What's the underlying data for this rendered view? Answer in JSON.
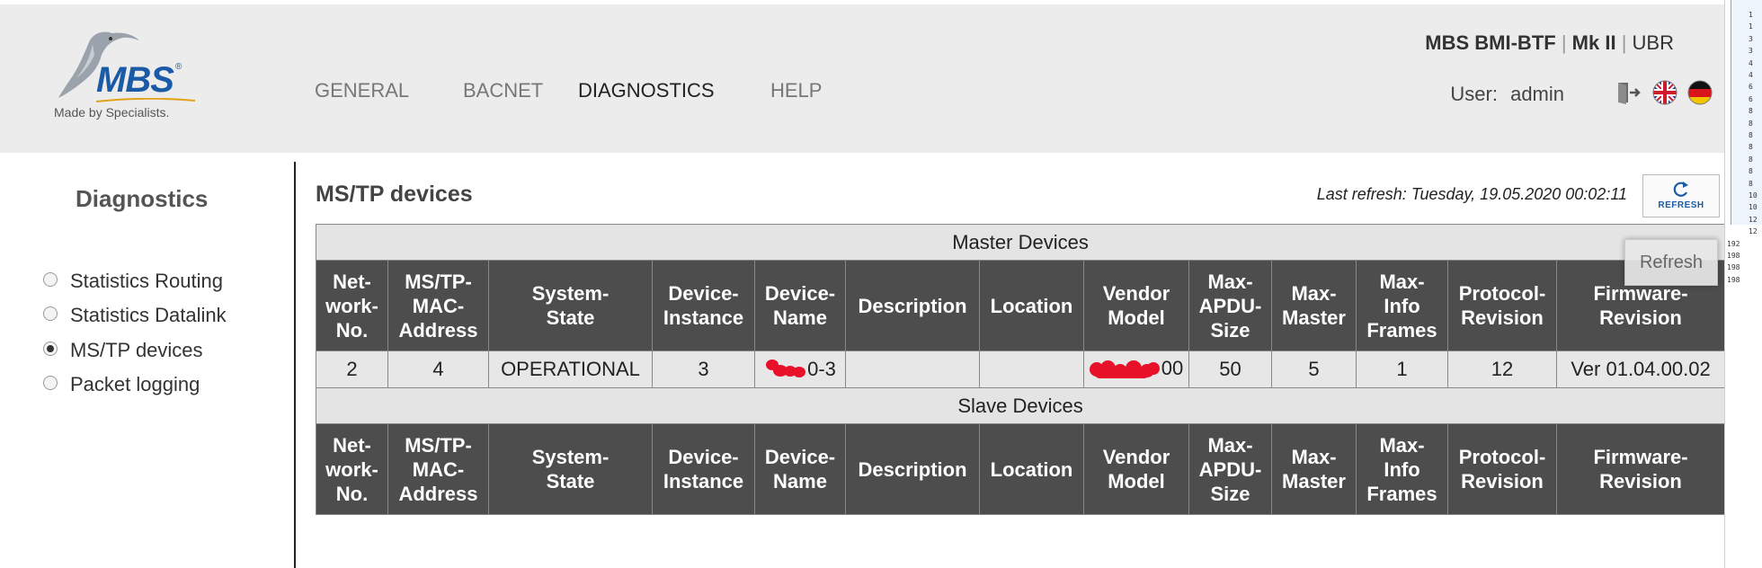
{
  "header": {
    "logo_text": "MBS",
    "logo_tagline": "Made by Specialists.",
    "nav": [
      {
        "label": "GENERAL",
        "active": false
      },
      {
        "label": "BACNET",
        "active": false
      },
      {
        "label": "DIAGNOSTICS",
        "active": true
      },
      {
        "label": "HELP",
        "active": false
      }
    ],
    "product_name": "MBS BMI-BTF",
    "product_sep1": "|",
    "product_model": "Mk II",
    "product_sep2": "|",
    "product_variant": "UBR",
    "user_label": "User:",
    "user_name": "admin",
    "icons": [
      "logout-icon",
      "flag-uk-icon",
      "flag-de-icon"
    ]
  },
  "sidebar": {
    "title": "Diagnostics",
    "items": [
      {
        "label": "Statistics Routing",
        "checked": false
      },
      {
        "label": "Statistics Datalink",
        "checked": false
      },
      {
        "label": "MS/TP devices",
        "checked": true
      },
      {
        "label": "Packet logging",
        "checked": false
      }
    ]
  },
  "main": {
    "title": "MS/TP devices",
    "last_refresh": "Last refresh: Tuesday, 19.05.2020 00:02:11",
    "refresh_button_label": "REFRESH",
    "refresh_tooltip": "Refresh",
    "table": {
      "master_caption": "Master Devices",
      "slave_caption": "Slave Devices",
      "columns": [
        [
          "Net-",
          "work-",
          "No."
        ],
        [
          "MS/TP-",
          "MAC-",
          "Address"
        ],
        [
          "System-",
          "State"
        ],
        [
          "Device-",
          "Instance"
        ],
        [
          "Device-",
          "Name"
        ],
        [
          "Description"
        ],
        [
          "Location"
        ],
        [
          "Vendor",
          "Model"
        ],
        [
          "Max-",
          "APDU-",
          "Size"
        ],
        [
          "Max-",
          "Master"
        ],
        [
          "Max-",
          "Info",
          "Frames"
        ],
        [
          "Protocol-",
          "Revision"
        ],
        [
          "Firmware-",
          "Revision"
        ]
      ],
      "master_rows": [
        {
          "network_no": "2",
          "mac_address": "4",
          "system_state": "OPERATIONAL",
          "device_instance": "3",
          "device_name_suffix": "0-3",
          "description": "",
          "location": "",
          "vendor_model_suffix": "00",
          "max_apdu_size": "50",
          "max_master": "5",
          "max_info_frames": "1",
          "protocol_revision": "12",
          "firmware_revision": "Ver 01.04.00.02"
        }
      ]
    }
  },
  "edge_numbers": [
    "1",
    "1",
    "3",
    "3",
    "4",
    "4",
    "6",
    "6",
    "8",
    "8",
    "8",
    "8",
    "8",
    "8",
    "8",
    "10",
    "10",
    "12",
    "12",
    "192",
    "198",
    "198",
    "198"
  ],
  "colors": {
    "header_bg": "#ececec",
    "table_header_bg": "#4d4d4d",
    "row_bg": "#e7e7e7",
    "accent": "#1a5aa6",
    "redaction": "#e8112a"
  }
}
